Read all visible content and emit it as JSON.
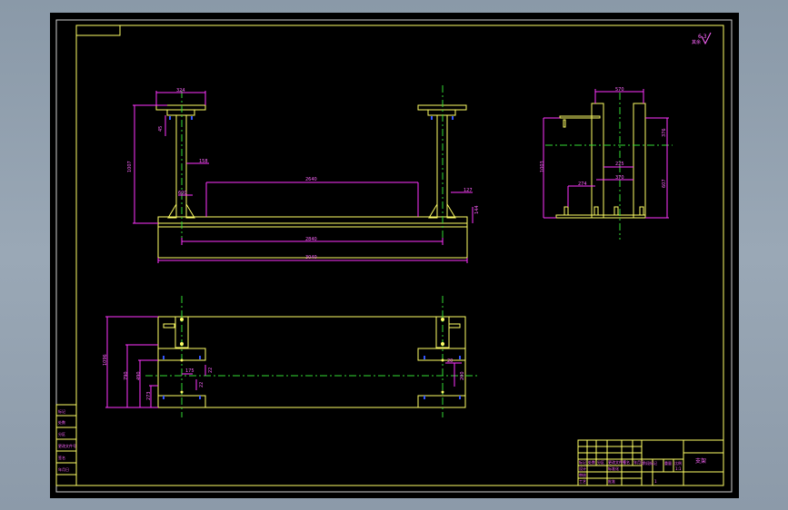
{
  "corner_marks": {
    "roughness_value": "6.3",
    "roughness_note": "其余"
  },
  "front_view": {
    "dims": {
      "top_plate_width": "324",
      "post_offset": "45",
      "total_height": "1007",
      "mid_offset": "158",
      "lower_offset": "600",
      "span_inner": "2640",
      "right_h": "127",
      "base_h": "144",
      "base_inner": "2840",
      "overall_length": "3040"
    }
  },
  "side_view": {
    "dims": {
      "top_width": "570",
      "height_total": "1003",
      "upper_h": "376",
      "mid_w": "225",
      "lower_left": "274",
      "lower_mid": "370",
      "right_h": "607"
    }
  },
  "top_view": {
    "dims": {
      "total_h": "1096",
      "h2": "790",
      "h3": "490",
      "h4": "273",
      "gap_a": "175",
      "gap_b": "22",
      "gap_c": "22",
      "r1": "20",
      "r2": "200"
    }
  },
  "side_table": {
    "rows": [
      "标记",
      "处数",
      "分区",
      "更改文件号",
      "签名",
      "年月日"
    ]
  },
  "title_block": {
    "drawing_name": "支架",
    "scale": "1:1",
    "sheet": "1",
    "small_cells": [
      "标记",
      "处数",
      "分区",
      "更改文件号",
      "签名",
      "年月日",
      "设计",
      "标准化",
      "审核",
      "工艺",
      "批准"
    ],
    "stage_labels": [
      "阶段标记",
      "重量",
      "比例"
    ]
  }
}
